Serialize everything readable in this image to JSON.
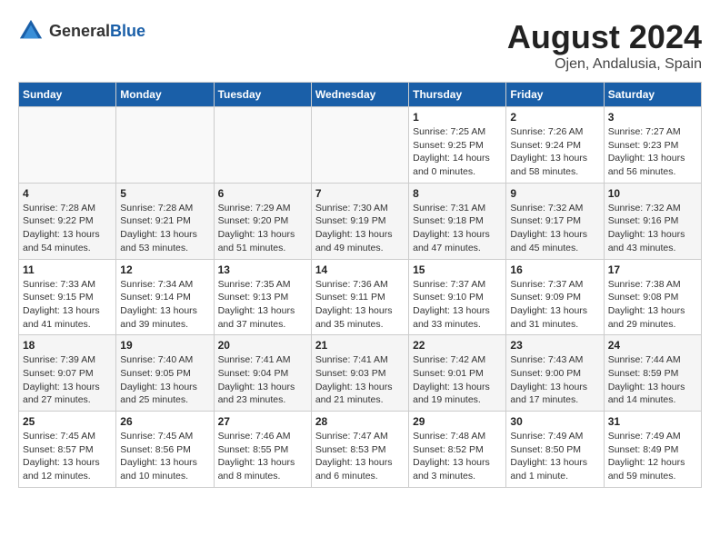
{
  "header": {
    "logo_general": "General",
    "logo_blue": "Blue",
    "month_year": "August 2024",
    "location": "Ojen, Andalusia, Spain"
  },
  "weekdays": [
    "Sunday",
    "Monday",
    "Tuesday",
    "Wednesday",
    "Thursday",
    "Friday",
    "Saturday"
  ],
  "weeks": [
    [
      {
        "day": "",
        "info": ""
      },
      {
        "day": "",
        "info": ""
      },
      {
        "day": "",
        "info": ""
      },
      {
        "day": "",
        "info": ""
      },
      {
        "day": "1",
        "info": "Sunrise: 7:25 AM\nSunset: 9:25 PM\nDaylight: 14 hours\nand 0 minutes."
      },
      {
        "day": "2",
        "info": "Sunrise: 7:26 AM\nSunset: 9:24 PM\nDaylight: 13 hours\nand 58 minutes."
      },
      {
        "day": "3",
        "info": "Sunrise: 7:27 AM\nSunset: 9:23 PM\nDaylight: 13 hours\nand 56 minutes."
      }
    ],
    [
      {
        "day": "4",
        "info": "Sunrise: 7:28 AM\nSunset: 9:22 PM\nDaylight: 13 hours\nand 54 minutes."
      },
      {
        "day": "5",
        "info": "Sunrise: 7:28 AM\nSunset: 9:21 PM\nDaylight: 13 hours\nand 53 minutes."
      },
      {
        "day": "6",
        "info": "Sunrise: 7:29 AM\nSunset: 9:20 PM\nDaylight: 13 hours\nand 51 minutes."
      },
      {
        "day": "7",
        "info": "Sunrise: 7:30 AM\nSunset: 9:19 PM\nDaylight: 13 hours\nand 49 minutes."
      },
      {
        "day": "8",
        "info": "Sunrise: 7:31 AM\nSunset: 9:18 PM\nDaylight: 13 hours\nand 47 minutes."
      },
      {
        "day": "9",
        "info": "Sunrise: 7:32 AM\nSunset: 9:17 PM\nDaylight: 13 hours\nand 45 minutes."
      },
      {
        "day": "10",
        "info": "Sunrise: 7:32 AM\nSunset: 9:16 PM\nDaylight: 13 hours\nand 43 minutes."
      }
    ],
    [
      {
        "day": "11",
        "info": "Sunrise: 7:33 AM\nSunset: 9:15 PM\nDaylight: 13 hours\nand 41 minutes."
      },
      {
        "day": "12",
        "info": "Sunrise: 7:34 AM\nSunset: 9:14 PM\nDaylight: 13 hours\nand 39 minutes."
      },
      {
        "day": "13",
        "info": "Sunrise: 7:35 AM\nSunset: 9:13 PM\nDaylight: 13 hours\nand 37 minutes."
      },
      {
        "day": "14",
        "info": "Sunrise: 7:36 AM\nSunset: 9:11 PM\nDaylight: 13 hours\nand 35 minutes."
      },
      {
        "day": "15",
        "info": "Sunrise: 7:37 AM\nSunset: 9:10 PM\nDaylight: 13 hours\nand 33 minutes."
      },
      {
        "day": "16",
        "info": "Sunrise: 7:37 AM\nSunset: 9:09 PM\nDaylight: 13 hours\nand 31 minutes."
      },
      {
        "day": "17",
        "info": "Sunrise: 7:38 AM\nSunset: 9:08 PM\nDaylight: 13 hours\nand 29 minutes."
      }
    ],
    [
      {
        "day": "18",
        "info": "Sunrise: 7:39 AM\nSunset: 9:07 PM\nDaylight: 13 hours\nand 27 minutes."
      },
      {
        "day": "19",
        "info": "Sunrise: 7:40 AM\nSunset: 9:05 PM\nDaylight: 13 hours\nand 25 minutes."
      },
      {
        "day": "20",
        "info": "Sunrise: 7:41 AM\nSunset: 9:04 PM\nDaylight: 13 hours\nand 23 minutes."
      },
      {
        "day": "21",
        "info": "Sunrise: 7:41 AM\nSunset: 9:03 PM\nDaylight: 13 hours\nand 21 minutes."
      },
      {
        "day": "22",
        "info": "Sunrise: 7:42 AM\nSunset: 9:01 PM\nDaylight: 13 hours\nand 19 minutes."
      },
      {
        "day": "23",
        "info": "Sunrise: 7:43 AM\nSunset: 9:00 PM\nDaylight: 13 hours\nand 17 minutes."
      },
      {
        "day": "24",
        "info": "Sunrise: 7:44 AM\nSunset: 8:59 PM\nDaylight: 13 hours\nand 14 minutes."
      }
    ],
    [
      {
        "day": "25",
        "info": "Sunrise: 7:45 AM\nSunset: 8:57 PM\nDaylight: 13 hours\nand 12 minutes."
      },
      {
        "day": "26",
        "info": "Sunrise: 7:45 AM\nSunset: 8:56 PM\nDaylight: 13 hours\nand 10 minutes."
      },
      {
        "day": "27",
        "info": "Sunrise: 7:46 AM\nSunset: 8:55 PM\nDaylight: 13 hours\nand 8 minutes."
      },
      {
        "day": "28",
        "info": "Sunrise: 7:47 AM\nSunset: 8:53 PM\nDaylight: 13 hours\nand 6 minutes."
      },
      {
        "day": "29",
        "info": "Sunrise: 7:48 AM\nSunset: 8:52 PM\nDaylight: 13 hours\nand 3 minutes."
      },
      {
        "day": "30",
        "info": "Sunrise: 7:49 AM\nSunset: 8:50 PM\nDaylight: 13 hours\nand 1 minute."
      },
      {
        "day": "31",
        "info": "Sunrise: 7:49 AM\nSunset: 8:49 PM\nDaylight: 12 hours\nand 59 minutes."
      }
    ]
  ]
}
